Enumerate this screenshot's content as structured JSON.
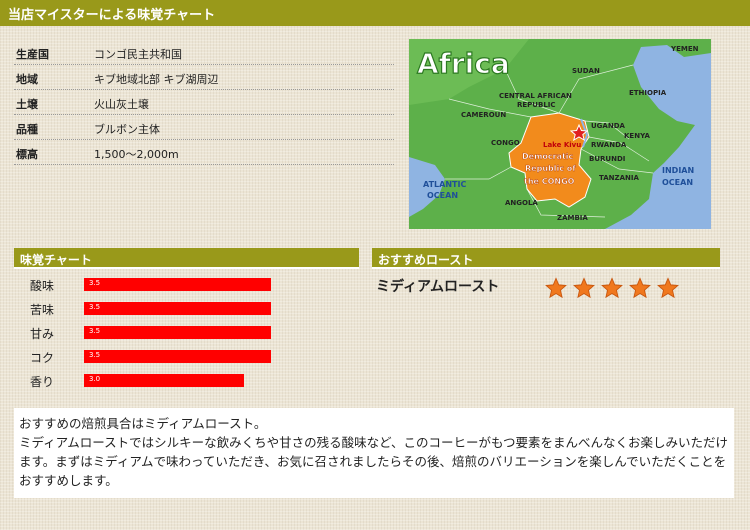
{
  "header": {
    "title": "当店マイスターによる味覚チャート"
  },
  "specs": [
    {
      "label": "生産国",
      "value": "コンゴ民主共和国"
    },
    {
      "label": "地域",
      "value": "キブ地域北部 キブ湖周辺"
    },
    {
      "label": "土壌",
      "value": "火山灰土壌"
    },
    {
      "label": "品種",
      "value": "ブルボン主体"
    },
    {
      "label": "標高",
      "value": "1,500〜2,000m"
    }
  ],
  "map": {
    "title": "Africa",
    "labels": {
      "yemen": "YEMEN",
      "sudan": "SUDAN",
      "ethiopia": "ETHIOPIA",
      "car1": "CENTRAL AFRICAN",
      "car2": "REPUBLIC",
      "cameroun": "CAMEROUN",
      "uganda": "UGANDA",
      "kenya": "KENYA",
      "rwanda": "RWANDA",
      "burundi": "BURUNDI",
      "congo": "CONGO",
      "lake_kivu": "Lake Kivu",
      "drc1": "Democratic",
      "drc2": "Republic of",
      "drc3": "the CONGO",
      "tanzania": "TANZANIA",
      "atlantic1": "ATLANTIC",
      "atlantic2": "OCEAN",
      "indian1": "INDIAN",
      "indian2": "OCEAN",
      "angola": "ANGOLA",
      "zambia": "ZAMBIA"
    },
    "colors": {
      "ocean": "#8fb4e2",
      "land": "#5db04a",
      "highlight": "#f28b1c",
      "marker": "#e02020"
    }
  },
  "taste": {
    "title": "味覚チャート",
    "max": 5,
    "items": [
      {
        "label": "酸味",
        "value": 3.5,
        "display": "3.5"
      },
      {
        "label": "苦味",
        "value": 3.5,
        "display": "3.5"
      },
      {
        "label": "甘み",
        "value": 3.5,
        "display": "3.5"
      },
      {
        "label": "コク",
        "value": 3.5,
        "display": "3.5"
      },
      {
        "label": "香り",
        "value": 3.0,
        "display": "3.0"
      }
    ],
    "bar_color": "#ff0000"
  },
  "roast": {
    "title": "おすすめロースト",
    "name": "ミディアムロースト",
    "stars": 5,
    "star_color": "#f0781e"
  },
  "description": {
    "text": "おすすめの焙煎具合はミディアムロースト。\nミディアムローストではシルキーな飲みくちや甘さの残る酸味など、このコーヒーがもつ要素をまんべんなくお楽しみいただけます。まずはミディアムで味わっていただき、お気に召されましたらその後、焙煎のバリエーションを楽しんでいただくことをおすすめします。"
  },
  "accent_color": "#99991a"
}
